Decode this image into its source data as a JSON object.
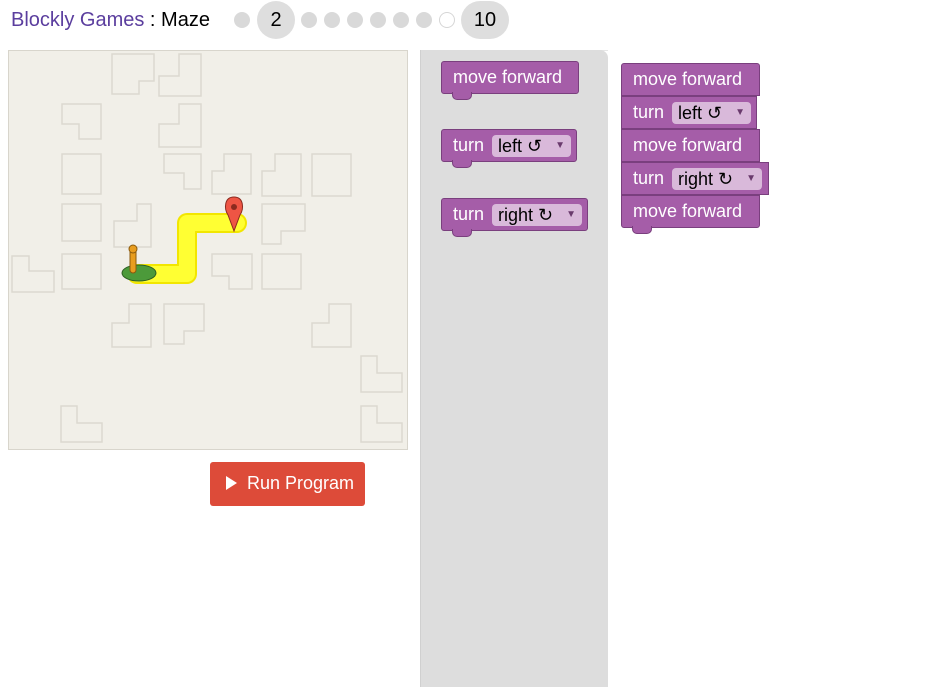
{
  "header": {
    "brand": "Blockly Games",
    "separator": " : ",
    "game": "Maze",
    "levels": {
      "current": "2",
      "last": "10",
      "completed_count": 1,
      "pending_count": 7
    }
  },
  "controls": {
    "run_button": "Run Program"
  },
  "toolbox": {
    "blocks": [
      {
        "label": "move forward"
      },
      {
        "label": "turn",
        "dropdown": "left ↺"
      },
      {
        "label": "turn",
        "dropdown": "right ↻"
      }
    ]
  },
  "workspace": {
    "program": [
      {
        "label": "move forward"
      },
      {
        "label": "turn",
        "dropdown": "left ↺"
      },
      {
        "label": "move forward"
      },
      {
        "label": "turn",
        "dropdown": "right ↻"
      },
      {
        "label": "move forward"
      }
    ]
  },
  "colors": {
    "brand": "#5b3e9e",
    "run_button": "#dd4b39",
    "block": "#a55da8",
    "path": "#ffff33",
    "goal_marker": "#ee5544",
    "maze_background": "#f1efe8"
  },
  "icons": {
    "goal": "map-pin-icon",
    "start": "pegman-start-icon",
    "play": "play-icon"
  }
}
